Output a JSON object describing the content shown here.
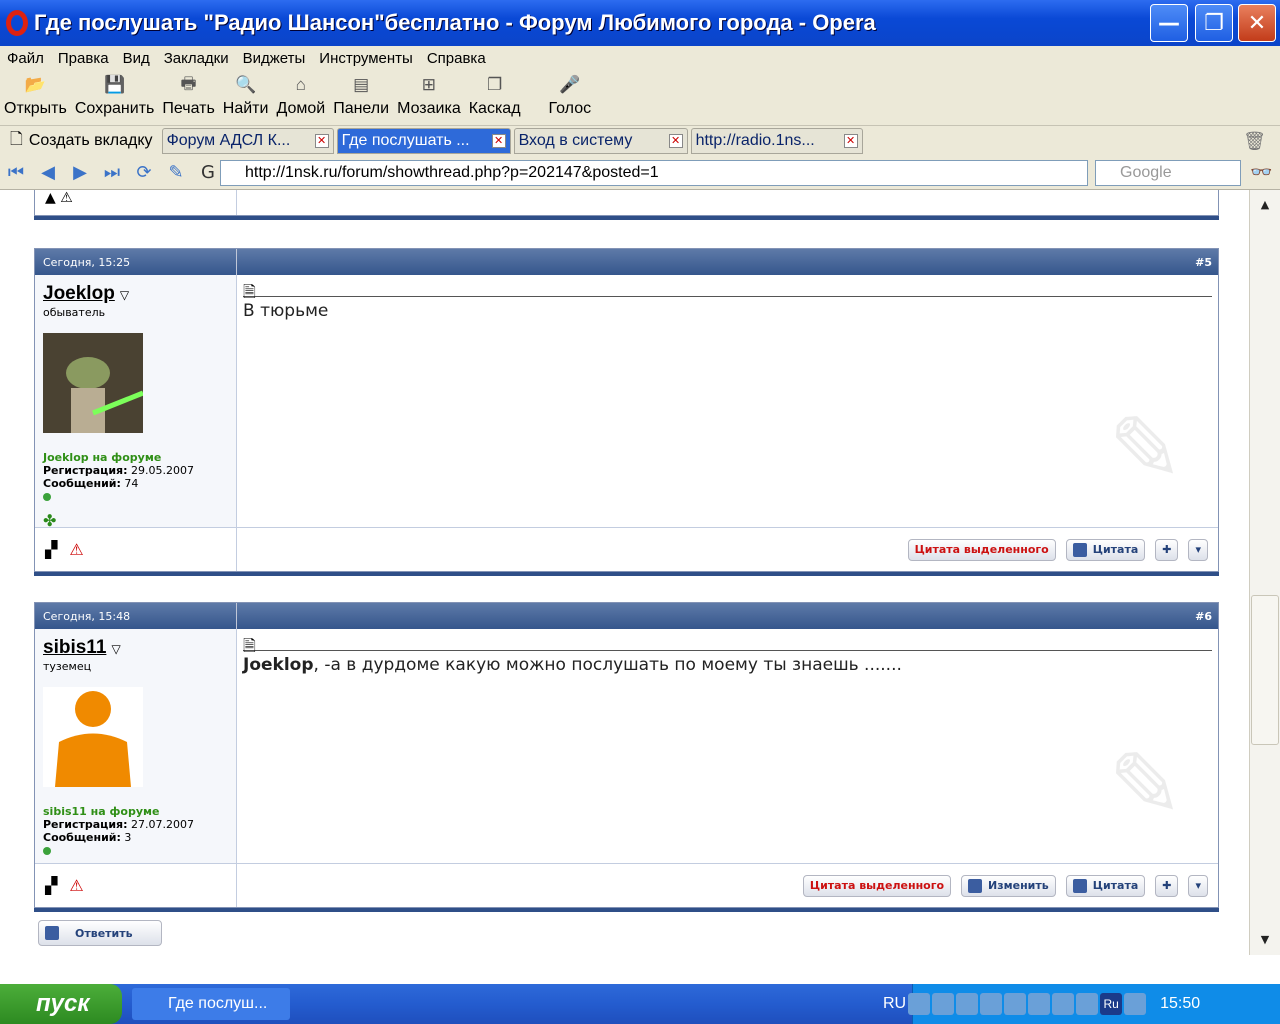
{
  "window": {
    "title": "Где послушать \"Радио Шансон\"бесплатно - Форум Любимого города - Opera",
    "min": "—",
    "max": "❐",
    "close": "✕"
  },
  "menu": [
    "Файл",
    "Правка",
    "Вид",
    "Закладки",
    "Виджеты",
    "Инструменты",
    "Справка"
  ],
  "toolbar": [
    {
      "label": "Открыть",
      "icon": "folder-icon"
    },
    {
      "label": "Сохранить",
      "icon": "save-icon"
    },
    {
      "label": "Печать",
      "icon": "print-icon"
    },
    {
      "label": "Найти",
      "icon": "find-icon"
    },
    {
      "label": "Домой",
      "icon": "home-icon"
    },
    {
      "label": "Панели",
      "icon": "panels-icon"
    },
    {
      "label": "Мозаика",
      "icon": "tile-icon"
    },
    {
      "label": "Каскад",
      "icon": "cascade-icon"
    },
    {
      "label": "Голос",
      "icon": "voice-icon"
    }
  ],
  "tabs": {
    "new_tab": "Создать вкладку",
    "items": [
      "Форум АДСЛ К...",
      "Где послушать ...",
      "Вход в систему",
      "http://radio.1ns..."
    ],
    "active": 1
  },
  "address": {
    "url": "http://1nsk.ru/forum/showthread.php?p=202147&posted=1",
    "search_placeholder": "Google"
  },
  "posts": [
    {
      "date": "Сегодня, 15:25",
      "num": "#5",
      "user": "Joeklop",
      "title": "обыватель",
      "online": "Joeklop на форуме",
      "reg_label": "Регистрация:",
      "reg": "29.05.2007",
      "msgs_label": "Сообщений:",
      "msgs": "74",
      "text_user": "",
      "text": "В тюрьме"
    },
    {
      "date": "Сегодня, 15:48",
      "num": "#6",
      "user": "sibis11",
      "title": "туземец",
      "online": "sibis11 на форуме",
      "reg_label": "Регистрация:",
      "reg": "27.07.2007",
      "msgs_label": "Сообщений:",
      "msgs": "3",
      "text_user": "Joeklop",
      "text": ", -а в дурдоме какую можно послушать по моему ты знаешь ......."
    }
  ],
  "buttons": {
    "quote_selected": "Цитата выделенного",
    "quote": "Цитата",
    "edit": "Изменить",
    "reply": "Ответить"
  },
  "taskbar": {
    "start": "пуск",
    "task": "Где послуш...",
    "lang": "RU",
    "lang2": "Ru",
    "clock": "15:50"
  }
}
